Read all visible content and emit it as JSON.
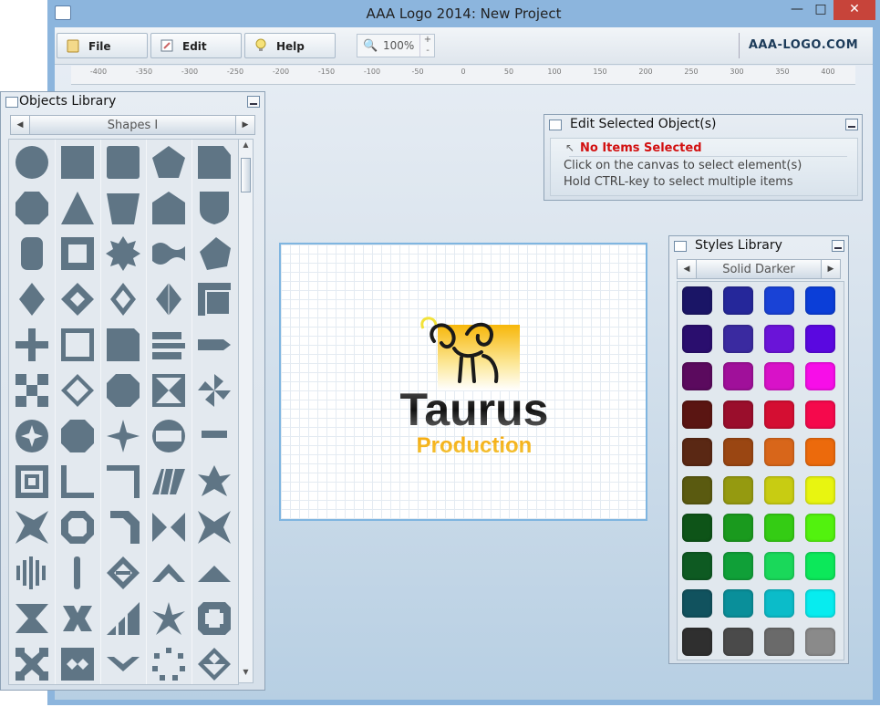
{
  "window": {
    "title": "AAA Logo 2014: New Project"
  },
  "toolbar": {
    "file": "File",
    "edit": "Edit",
    "help": "Help",
    "zoom": "100%",
    "zoom_up": "+",
    "zoom_down": "-",
    "brand": "AAA-LOGO.COM"
  },
  "ruler": {
    "ticks": [
      "-400",
      "-350",
      "-300",
      "-250",
      "-200",
      "-150",
      "-100",
      "-50",
      "0",
      "50",
      "100",
      "150",
      "200",
      "250",
      "300",
      "350",
      "400"
    ]
  },
  "objects_library": {
    "title": "Objects Library",
    "category": "Shapes I",
    "shapes": [
      "circle",
      "square",
      "rounded-square",
      "pentagon",
      "cut-square",
      "heptagon",
      "triangle",
      "trapezoid",
      "house-pentagon",
      "shield",
      "stadium",
      "square-frame",
      "star8",
      "wave-banner",
      "rotated-pentagon",
      "diamond",
      "frame-diamond",
      "outlined-diamond",
      "split-diamond",
      "layered-square",
      "plus",
      "square-outline",
      "folded-square",
      "arrow-stack",
      "arrow-right",
      "checker",
      "diamond-outline",
      "octagon",
      "triangle-square",
      "pinwheel",
      "circle-star",
      "heptagon-big",
      "star4",
      "circle-band",
      "small-bar",
      "square-spiral",
      "l-corner",
      "corner-bracket",
      "parallelogram-stripes",
      "swirl-star",
      "concave-star",
      "octagon-frame",
      "hook-shape",
      "bow-tie",
      "butterfly",
      "bar-burst",
      "vertical-bar",
      "triangle-frame",
      "chevron-up",
      "chevron-up-2",
      "k-shape",
      "x-shape",
      "ascending-bars",
      "ninja-star",
      "cross-frame",
      "square-x",
      "square-notch",
      "chevron-down",
      "dotted-ring",
      "diamond-lattice"
    ]
  },
  "edit_panel": {
    "title": "Edit Selected Object(s)",
    "status": "No Items Selected",
    "hint1": "Click on the canvas to select element(s)",
    "hint2": "Hold CTRL-key to select multiple items"
  },
  "styles_library": {
    "title": "Styles Library",
    "category": "Solid Darker",
    "colors": [
      "#1a1566",
      "#25279a",
      "#1942d6",
      "#0b3ed8",
      "#2a0e6e",
      "#3a2aa0",
      "#6a14d8",
      "#5a08e0",
      "#5b0a5e",
      "#a0109a",
      "#d812c8",
      "#f70ee8",
      "#5a1512",
      "#9a0e2c",
      "#d40e32",
      "#f5094c",
      "#5a2814",
      "#9a4612",
      "#d8661a",
      "#ec6a0c",
      "#5a5a10",
      "#959a10",
      "#c8cc12",
      "#e8f510",
      "#0e5418",
      "#1a9a1e",
      "#34cc14",
      "#52f20e",
      "#0e5a22",
      "#10a038",
      "#1ad85a",
      "#0ce85a",
      "#11525e",
      "#0a8f9a",
      "#0bbcc9",
      "#07ecef",
      "#2f2f2f",
      "#4a4a4a",
      "#6a6a6a",
      "#8a8a8a"
    ]
  },
  "logo": {
    "word1": "Taurus",
    "word2": "Production"
  }
}
